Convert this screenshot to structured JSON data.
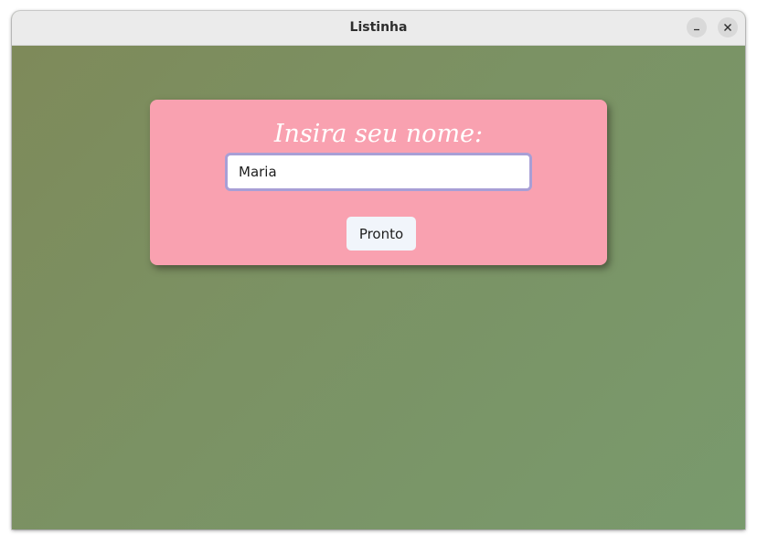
{
  "window": {
    "title": "Listinha",
    "minimize_icon": "minimize-icon",
    "close_icon": "close-icon"
  },
  "form": {
    "heading": "Insira seu nome:",
    "name_value": "Maria",
    "submit_label": "Pronto"
  },
  "colors": {
    "background": "#7d9266",
    "card": "#f9a1b0",
    "input_border": "#a89fd6",
    "button": "#f1f5fb"
  }
}
